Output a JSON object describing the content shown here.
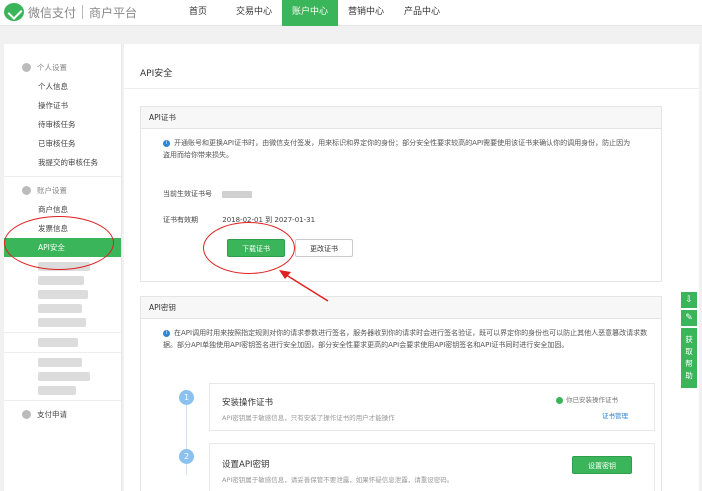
{
  "brand": {
    "name": "微信支付",
    "sub": "商户平台"
  },
  "nav": [
    "首页",
    "交易中心",
    "账户中心",
    "营销中心",
    "产品中心"
  ],
  "nav_active_index": 2,
  "sidebar": {
    "group_personal": "个人设置",
    "personal_items": [
      "个人信息",
      "操作证书",
      "待审核任务",
      "已审核任务",
      "我提交的审核任务"
    ],
    "group_account": "账户设置",
    "account_items": [
      "商户信息",
      "发票信息",
      "API安全"
    ],
    "active_item": "API安全",
    "bottom_item": "支付申请"
  },
  "main": {
    "title": "API安全",
    "cert_panel": {
      "heading": "API证书",
      "notice": "开通账号和更换API证书时，由微信支付签发，用来标识和界定你的身份；部分安全性要求较高的API需要使用该证书来确认你的调用身份，防止因为盗用而给你带来损失。",
      "current_label": "当前生效证书号",
      "validity_label": "证书有效期",
      "validity_value": "2018-02-01 到 2027-01-31",
      "download_button": "下载证书",
      "change_button": "更改证书"
    },
    "key_panel": {
      "heading": "API密钥",
      "notice": "在API调用时用来按照指定规则对你的请求参数进行签名，服务器收到你的请求时会进行签名验证，既可以界定你的身份也可以防止其他人恶意篡改请求数据。部分API单独使用API密钥签名进行安全加固，部分安全性要求更高的API会要求使用API密钥签名和API证书同时进行安全加固。",
      "steps": [
        {
          "num": "1",
          "title": "安装操作证书",
          "desc": "API密钥属于敏感信息，只有安装了操作证书的用户才能操作",
          "status": "你已安装操作证书",
          "link": "证书管理"
        },
        {
          "num": "2",
          "title": "设置API密钥",
          "desc": "API密钥属于敏感信息，请妥善保管不要泄露，如果怀疑信息泄露，请重设密码。",
          "button": "设置密钥"
        }
      ]
    }
  },
  "float_tools": {
    "help": "获取帮助"
  },
  "colors": {
    "brand_green": "#3ab55a",
    "info_blue": "#2f85d0",
    "annotation_red": "#e02020"
  }
}
